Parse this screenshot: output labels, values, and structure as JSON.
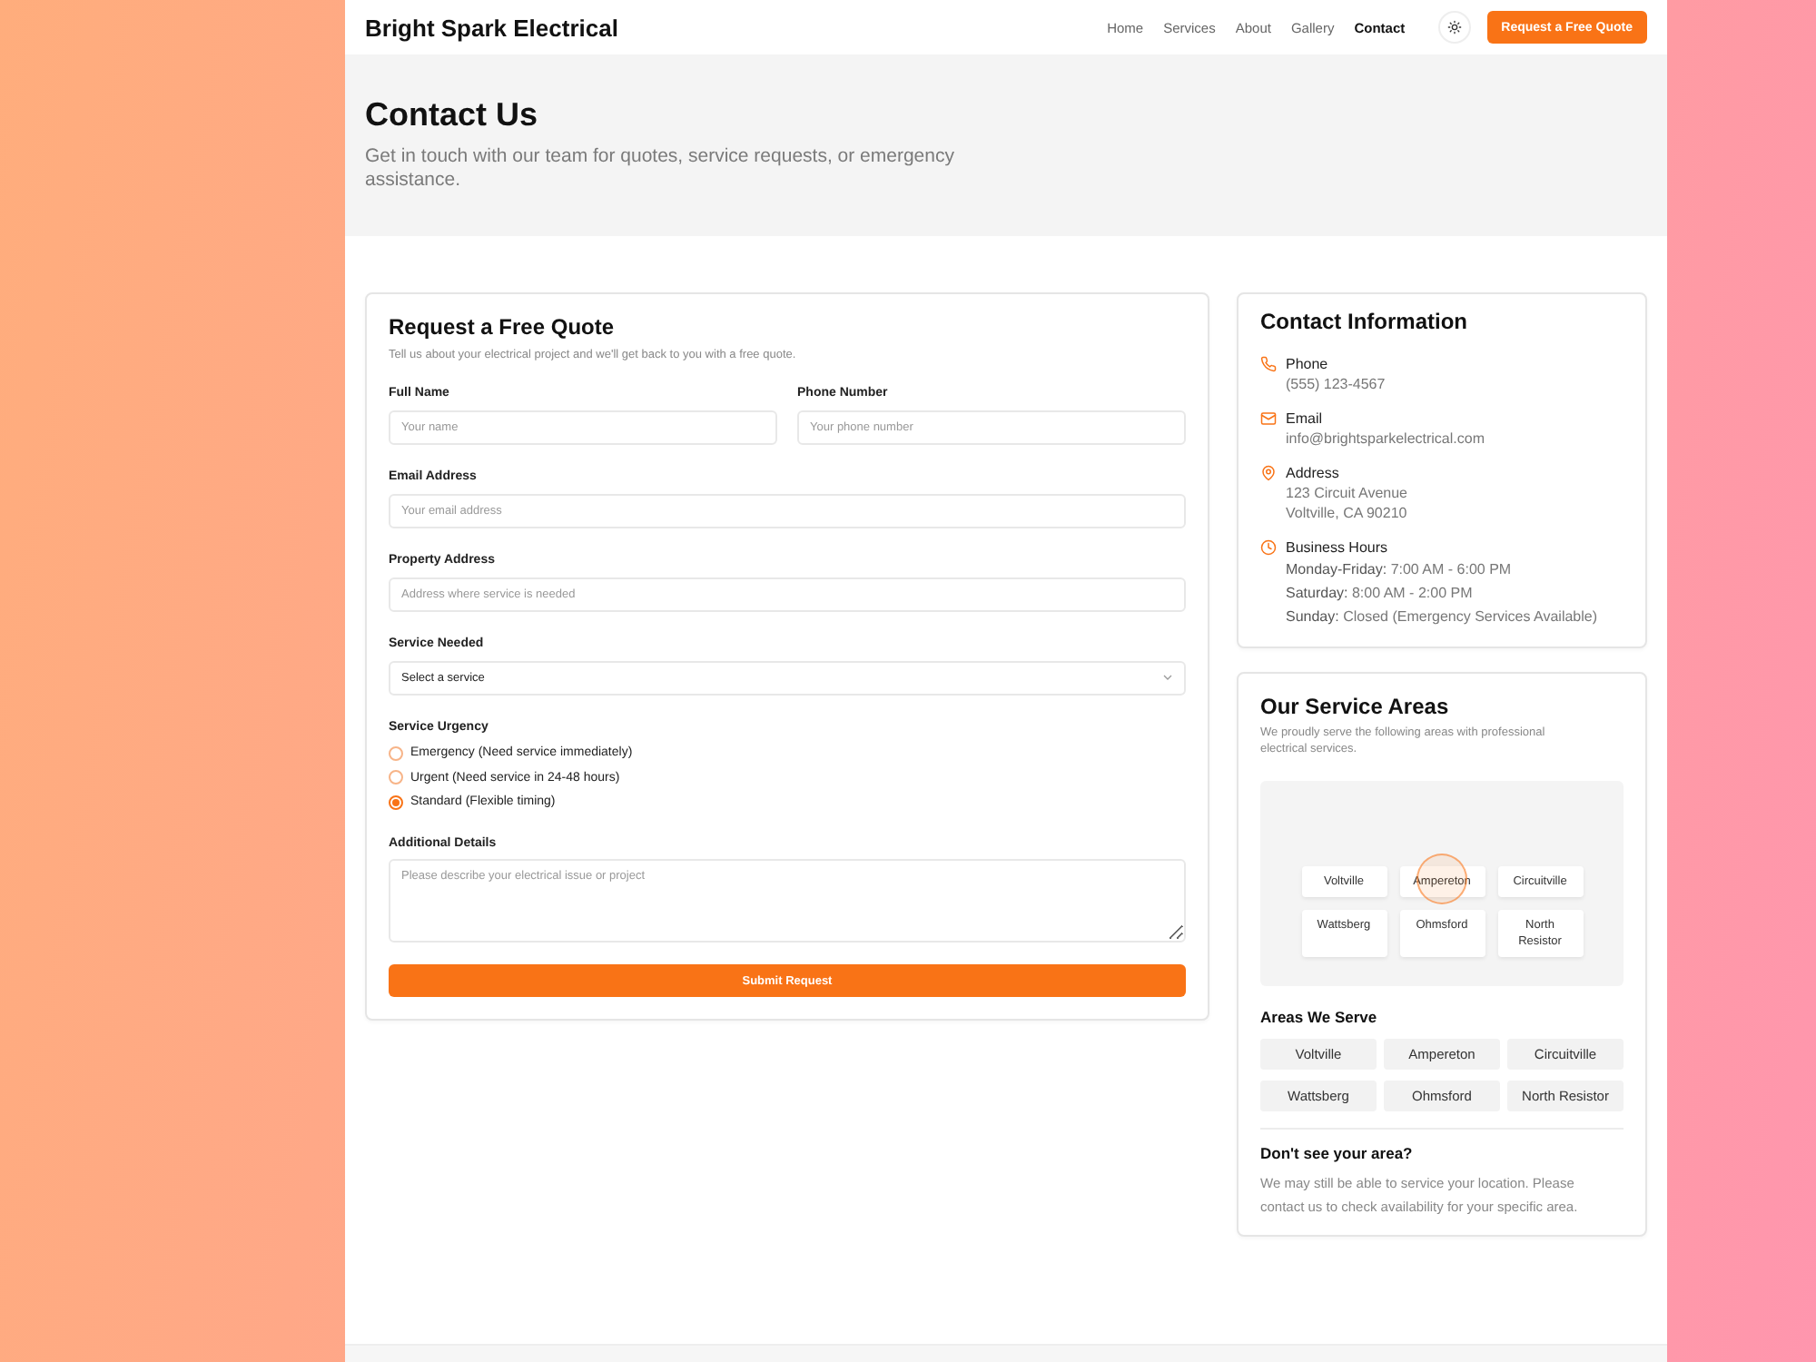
{
  "header": {
    "brand": "Bright Spark Electrical",
    "nav": [
      {
        "label": "Home",
        "selected": false
      },
      {
        "label": "Services",
        "selected": false
      },
      {
        "label": "About",
        "selected": false
      },
      {
        "label": "Gallery",
        "selected": false
      },
      {
        "label": "Contact",
        "selected": true
      }
    ],
    "cta": "Request a Free Quote"
  },
  "hero": {
    "title": "Contact Us",
    "subtitle": "Get in touch with our team for quotes, service requests, or emergency assistance."
  },
  "form": {
    "title": "Request a Free Quote",
    "description": "Tell us about your electrical project and we'll get back to you with a free quote.",
    "rows": [
      [
        {
          "kind": "text",
          "label": "Full Name",
          "placeholder": "Your name"
        },
        {
          "kind": "text",
          "label": "Phone Number",
          "placeholder": "Your phone number"
        }
      ],
      [
        {
          "kind": "text",
          "label": "Email Address",
          "placeholder": "Your email address"
        }
      ],
      [
        {
          "kind": "text",
          "label": "Property Address",
          "placeholder": "Address where service is needed"
        }
      ],
      [
        {
          "kind": "select",
          "label": "Service Needed",
          "value": "Select a service"
        }
      ],
      [
        {
          "kind": "radio",
          "label": "Service Urgency",
          "options": [
            {
              "label": "Emergency (Need service immediately)",
              "selected": false
            },
            {
              "label": "Urgent (Need service in 24-48 hours)",
              "selected": false
            },
            {
              "label": "Standard (Flexible timing)",
              "selected": true
            }
          ]
        }
      ],
      [
        {
          "kind": "textarea",
          "label": "Additional Details",
          "placeholder": "Please describe your electrical issue or project"
        }
      ]
    ],
    "submit": "Submit Request"
  },
  "contact": {
    "title": "Contact Information",
    "items": [
      {
        "kind": "phone",
        "label": "Phone",
        "lines": [
          {
            "text": "(555) 123-4567"
          }
        ]
      },
      {
        "kind": "email",
        "label": "Email",
        "lines": [
          {
            "text": "info@brightsparkelectrical.com"
          }
        ]
      },
      {
        "kind": "address",
        "label": "Address",
        "lines": [
          {
            "text": "123 Circuit Avenue"
          },
          {
            "text": "Voltville, CA 90210"
          }
        ]
      },
      {
        "kind": "hours",
        "label": "Business Hours",
        "lines": [
          {
            "day": "Monday-Friday:",
            "text": "7:00 AM - 6:00 PM"
          },
          {
            "day": "Saturday:",
            "text": "8:00 AM - 2:00 PM"
          },
          {
            "day": "Sunday:",
            "text": "Closed (Emergency Services Available)"
          }
        ]
      }
    ]
  },
  "service_areas": {
    "title": "Our Service Areas",
    "description": "We proudly serve the following areas with professional electrical services.",
    "map": {
      "areas": [
        "Voltville",
        "Ampereton",
        "Circuitville",
        "Wattsberg",
        "Ohmsford",
        "North Resistor"
      ]
    },
    "list": {
      "title": "Areas We Serve",
      "items": [
        "Voltville",
        "Ampereton",
        "Circuitville",
        "Wattsberg",
        "Ohmsford",
        "North Resistor"
      ]
    },
    "note": {
      "title": "Don't see your area?",
      "text": "We may still be able to service your location. Please contact us to check availability for your specific area."
    }
  }
}
